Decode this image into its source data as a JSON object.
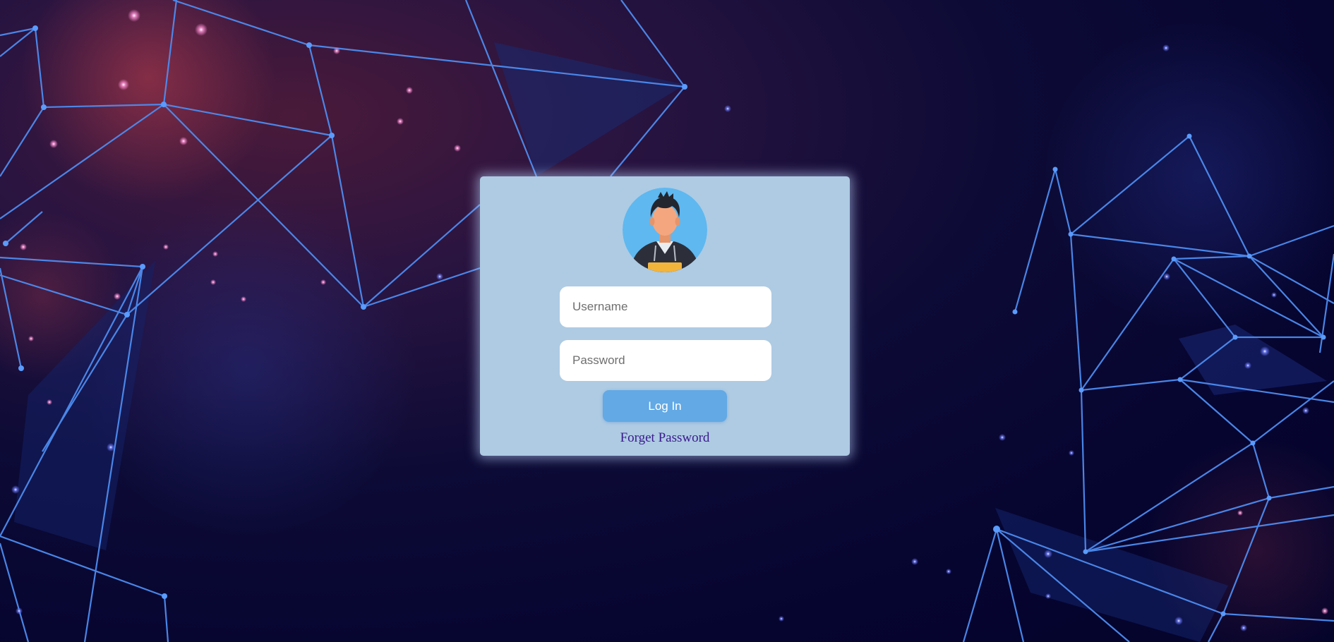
{
  "login": {
    "username_placeholder": "Username",
    "password_placeholder": "Password",
    "login_label": "Log In",
    "forget_label": "Forget Password"
  },
  "icons": {
    "avatar": "user-avatar-icon"
  },
  "colors": {
    "card_background": "#aecbe3",
    "login_button": "#62a9e5",
    "forget_link": "#3a1a8c",
    "network_lines": "#4d8cf0",
    "page_background": "#060530"
  }
}
